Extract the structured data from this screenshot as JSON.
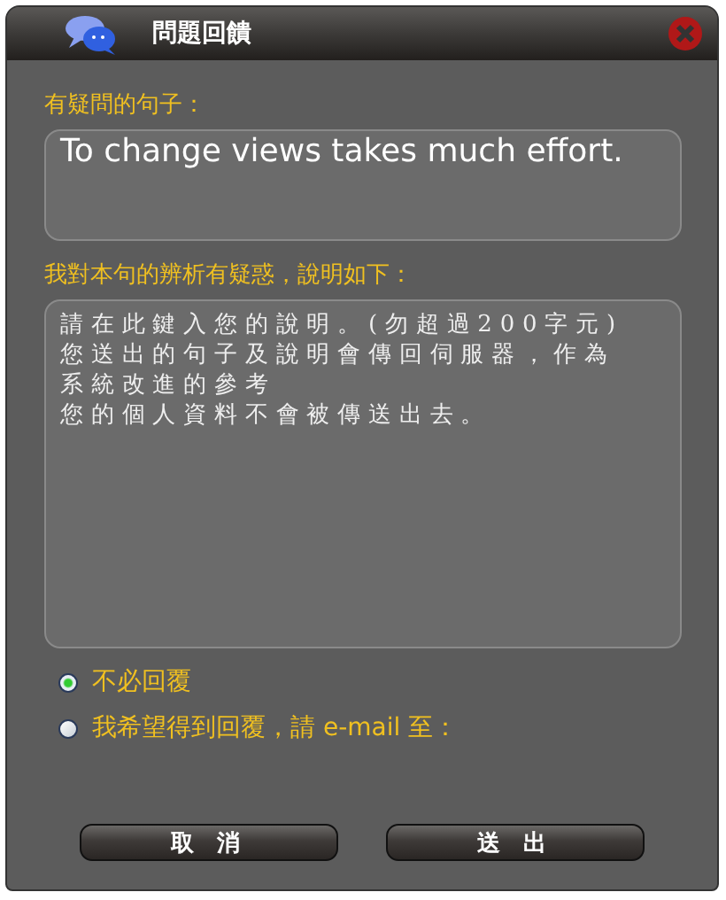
{
  "window": {
    "title": "問題回饋"
  },
  "sentence": {
    "label": "有疑問的句子：",
    "value": "To change views takes much effort."
  },
  "comment": {
    "label": "我對本句的辨析有疑惑，說明如下：",
    "placeholder": [
      "請在此鍵入您的說明。(勿超過200字元)",
      "您送出的句子及說明會傳回伺服器，作為系統改進的參考",
      "您的個人資料不會被傳送出去。"
    ]
  },
  "reply_options": [
    {
      "label": "不必回覆",
      "selected": true
    },
    {
      "label": "我希望得到回覆，請 e-mail 至：",
      "selected": false
    }
  ],
  "buttons": [
    "取 消",
    "送 出"
  ]
}
